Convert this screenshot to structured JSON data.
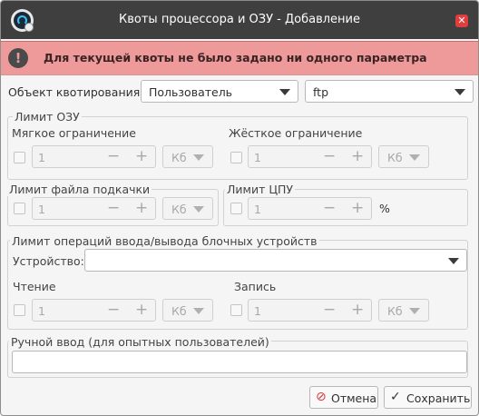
{
  "window": {
    "title": "Квоты процессора и ОЗУ - Добавление",
    "close_glyph": "✕"
  },
  "alert": {
    "icon_glyph": "!",
    "text": "Для текущей квоты не было задано ни одного параметра"
  },
  "object": {
    "label": "Объект квотирования:",
    "type_value": "Пользователь",
    "name_value": "ftp"
  },
  "ram_limit": {
    "title": "Лимит ОЗУ",
    "soft": {
      "label": "Мягкое ограничение",
      "value": "1",
      "unit": "Кб"
    },
    "hard": {
      "label": "Жёсткое ограничение",
      "value": "1",
      "unit": "Кб"
    }
  },
  "swap_limit": {
    "title": "Лимит файла подкачки",
    "value": "1",
    "unit": "Кб"
  },
  "cpu_limit": {
    "title": "Лимит ЦПУ",
    "value": "1",
    "unit": "%"
  },
  "io_limit": {
    "title": "Лимит операций ввода/вывода блочных устройств",
    "device_label": "Устройство:",
    "device_value": "",
    "read": {
      "label": "Чтение",
      "value": "1",
      "unit": "Кб"
    },
    "write": {
      "label": "Запись",
      "value": "1",
      "unit": "Кб"
    }
  },
  "manual": {
    "title": "Ручной ввод (для опытных пользователей)",
    "value": ""
  },
  "spin_glyphs": {
    "minus": "−",
    "plus": "+"
  },
  "buttons": {
    "cancel": {
      "label": "Отмена",
      "icon": "cancel-icon",
      "glyph": "⊘"
    },
    "save": {
      "label": "Сохранить",
      "icon": "checkmark-icon",
      "glyph": "✓"
    }
  },
  "colors": {
    "titlebar": "#3f3f3f",
    "alert_background": "#ef9a9a",
    "close_button": "#e03d3d",
    "cancel_icon": "#d63a3a"
  }
}
